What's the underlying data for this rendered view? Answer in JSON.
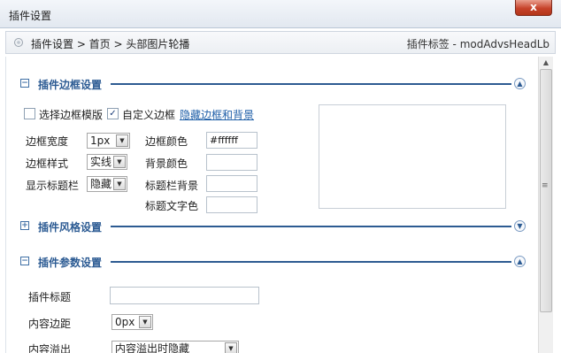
{
  "window": {
    "title": "插件设置",
    "close_label": "x"
  },
  "breadcrumb": {
    "path": "插件设置 > 首页 > 头部图片轮播",
    "tag": "插件标签 - modAdvsHeadLb"
  },
  "sections": {
    "border": {
      "title": "插件边框设置",
      "toggle": "⊟",
      "collapse_icon": "︽"
    },
    "style": {
      "title": "插件风格设置",
      "toggle": "⊞",
      "collapse_icon": "︾"
    },
    "params": {
      "title": "插件参数设置",
      "toggle": "⊟",
      "collapse_icon": "︽"
    }
  },
  "border_settings": {
    "template_checkbox_label": "选择边框模版",
    "template_checked": false,
    "custom_checkbox_label": "自定义边框",
    "custom_checked": true,
    "hide_link": "隐藏边框和背景",
    "width_label": "边框宽度",
    "width_value": "1px",
    "style_label": "边框样式",
    "style_value": "实线",
    "titlebar_label": "显示标题栏",
    "titlebar_value": "隐藏",
    "border_color_label": "边框颜色",
    "border_color_value": "#ffffff",
    "bg_color_label": "背景颜色",
    "bg_color_value": "",
    "title_bg_label": "标题栏背景",
    "title_bg_value": "",
    "title_text_color_label": "标题文字色",
    "title_text_color_value": ""
  },
  "param_settings": {
    "title_label": "插件标题",
    "title_value": "",
    "padding_label": "内容边距",
    "padding_value": "0px",
    "overflow_label": "内容溢出",
    "overflow_value": "内容溢出时隐藏"
  }
}
